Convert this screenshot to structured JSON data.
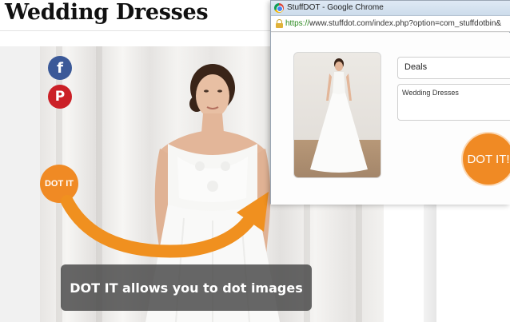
{
  "page": {
    "title": "Wedding Dresses"
  },
  "social": {
    "facebook_glyph": "f",
    "pinterest_glyph": "P"
  },
  "overlay": {
    "dot_badge_label": "DOT IT",
    "caption": "DOT IT allows you to dot images"
  },
  "popup": {
    "window_title": "StuffDOT - Google Chrome",
    "url_scheme": "https://",
    "url_rest": "www.stuffdot.com/index.php?option=com_stuffdotbin&",
    "board_value": "Deals",
    "description_value": "Wedding Dresses",
    "dot_button_label": "DOT IT!"
  },
  "colors": {
    "accent_orange": "#f08a24",
    "facebook_blue": "#3b5998",
    "pinterest_red": "#cb2027"
  }
}
